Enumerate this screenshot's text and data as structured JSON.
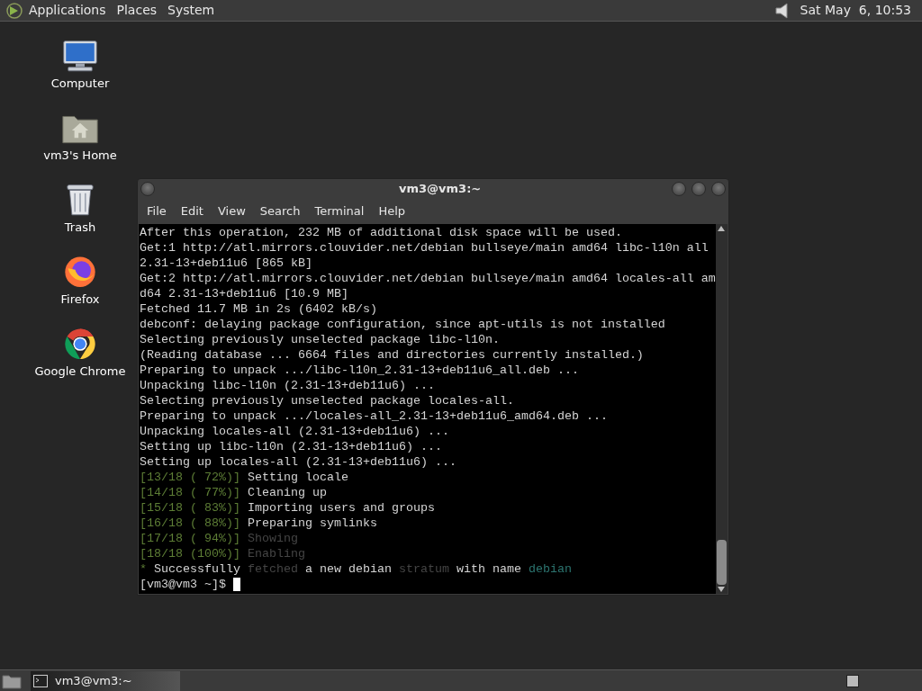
{
  "top_panel": {
    "menus": [
      "Applications",
      "Places",
      "System"
    ],
    "clock": "Sat May  6, 10:53"
  },
  "desktop_icons": [
    {
      "kind": "computer",
      "label": "Computer"
    },
    {
      "kind": "home",
      "label": "vm3's Home"
    },
    {
      "kind": "trash",
      "label": "Trash"
    },
    {
      "kind": "firefox",
      "label": "Firefox"
    },
    {
      "kind": "chrome",
      "label": "Google Chrome"
    }
  ],
  "terminal": {
    "title": "vm3@vm3:~",
    "menu": [
      "File",
      "Edit",
      "View",
      "Search",
      "Terminal",
      "Help"
    ],
    "lines": [
      [
        {
          "kind": "text",
          "text": "After this operation, 232 MB of additional disk space will be used."
        }
      ],
      [
        {
          "kind": "text",
          "text": "Get:1 http://atl.mirrors.clouvider.net/debian bullseye/main amd64 libc-l10n all"
        }
      ],
      [
        {
          "kind": "text",
          "text": "2.31-13+deb11u6 [865 kB]"
        }
      ],
      [
        {
          "kind": "text",
          "text": "Get:2 http://atl.mirrors.clouvider.net/debian bullseye/main amd64 locales-all am"
        }
      ],
      [
        {
          "kind": "text",
          "text": "d64 2.31-13+deb11u6 [10.9 MB]"
        }
      ],
      [
        {
          "kind": "text",
          "text": "Fetched 11.7 MB in 2s (6402 kB/s)"
        }
      ],
      [
        {
          "kind": "text",
          "text": "debconf: delaying package configuration, since apt-utils is not installed"
        }
      ],
      [
        {
          "kind": "text",
          "text": "Selecting previously unselected package libc-l10n."
        }
      ],
      [
        {
          "kind": "text",
          "text": "(Reading database ... 6664 files and directories currently installed.)"
        }
      ],
      [
        {
          "kind": "text",
          "text": "Preparing to unpack .../libc-l10n_2.31-13+deb11u6_all.deb ..."
        }
      ],
      [
        {
          "kind": "text",
          "text": "Unpacking libc-l10n (2.31-13+deb11u6) ..."
        }
      ],
      [
        {
          "kind": "text",
          "text": "Selecting previously unselected package locales-all."
        }
      ],
      [
        {
          "kind": "text",
          "text": "Preparing to unpack .../locales-all_2.31-13+deb11u6_amd64.deb ..."
        }
      ],
      [
        {
          "kind": "text",
          "text": "Unpacking locales-all (2.31-13+deb11u6) ..."
        }
      ],
      [
        {
          "kind": "text",
          "text": "Setting up libc-l10n (2.31-13+deb11u6) ..."
        }
      ],
      [
        {
          "kind": "text",
          "text": "Setting up locales-all (2.31-13+deb11u6) ..."
        }
      ],
      [
        {
          "kind": "progress",
          "text": "[13/18 ( 72%)]"
        },
        {
          "kind": "text",
          "text": " Setting locale"
        }
      ],
      [
        {
          "kind": "progress",
          "text": "[14/18 ( 77%)]"
        },
        {
          "kind": "text",
          "text": " Cleaning up"
        }
      ],
      [
        {
          "kind": "progress",
          "text": "[15/18 ( 83%)]"
        },
        {
          "kind": "text",
          "text": " Importing users and groups"
        }
      ],
      [
        {
          "kind": "progress",
          "text": "[16/18 ( 88%)]"
        },
        {
          "kind": "text",
          "text": " Preparing symlinks"
        }
      ],
      [
        {
          "kind": "progress",
          "text": "[17/18 ( 94%)]"
        },
        {
          "kind": "dim",
          "text": " Showing"
        }
      ],
      [
        {
          "kind": "progress",
          "text": "[18/18 (100%)]"
        },
        {
          "kind": "dim",
          "text": " Enabling"
        }
      ],
      [
        {
          "kind": "progress",
          "text": "*"
        },
        {
          "kind": "text",
          "text": " Successfully "
        },
        {
          "kind": "dim",
          "text": "fetched"
        },
        {
          "kind": "text",
          "text": " a new debian "
        },
        {
          "kind": "dim",
          "text": "stratum"
        },
        {
          "kind": "text",
          "text": " with name "
        },
        {
          "kind": "accent",
          "text": "debian"
        }
      ],
      [
        {
          "kind": "text",
          "text": "[vm3@vm3 ~]$ "
        }
      ]
    ]
  },
  "taskbar": {
    "windows": [
      {
        "label": "vm3@vm3:~",
        "selected": true
      }
    ]
  }
}
